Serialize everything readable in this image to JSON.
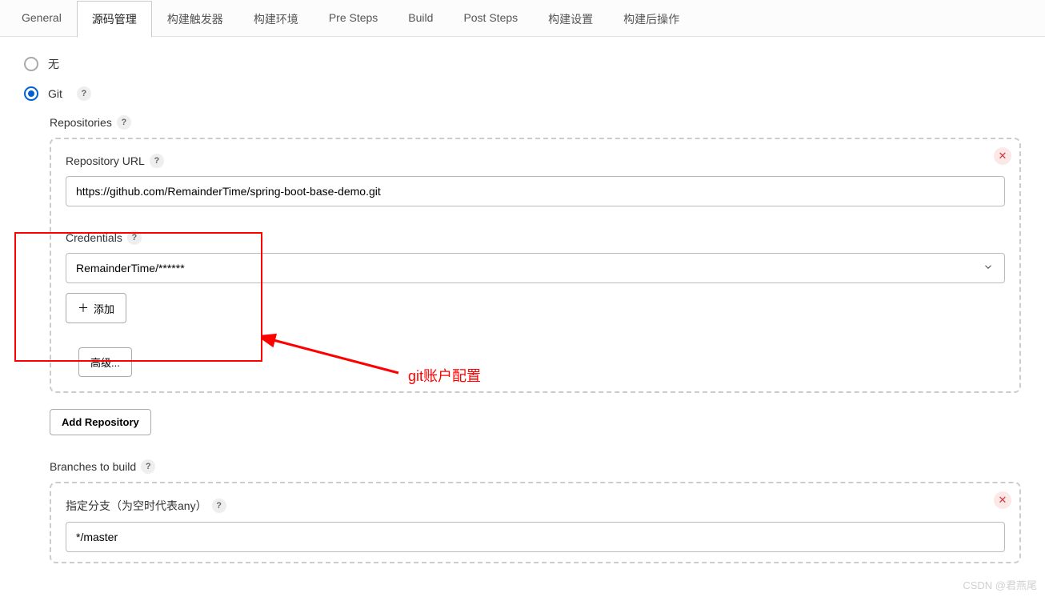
{
  "tabs": [
    "General",
    "源码管理",
    "构建触发器",
    "构建环境",
    "Pre Steps",
    "Build",
    "Post Steps",
    "构建设置",
    "构建后操作"
  ],
  "activeTabIndex": 1,
  "scm": {
    "none_label": "无",
    "git_label": "Git",
    "repositories_label": "Repositories",
    "repo_url_label": "Repository URL",
    "repo_url_value": "https://github.com/RemainderTime/spring-boot-base-demo.git",
    "credentials_label": "Credentials",
    "credentials_value": "RemainderTime/******",
    "add_btn": "添加",
    "advanced_btn": "高级...",
    "add_repo_btn": "Add Repository",
    "branches_label": "Branches to build",
    "branch_specifier_label": "指定分支（为空时代表any）",
    "branch_specifier_value": "*/master"
  },
  "annotation": {
    "text": "git账户配置"
  },
  "watermark": "CSDN @君燕尾"
}
